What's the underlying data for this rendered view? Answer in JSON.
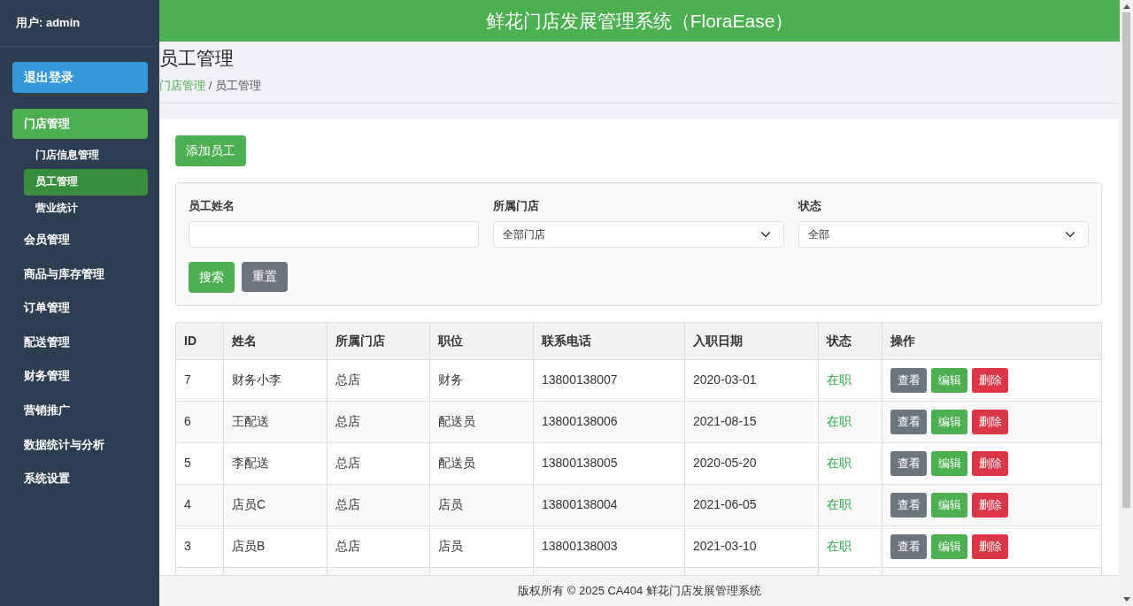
{
  "sidebar": {
    "user": "用户: admin",
    "logout": "退出登录",
    "menu": [
      {
        "label": "门店管理",
        "selected": true,
        "children": [
          {
            "label": "门店信息管理",
            "selected": false
          },
          {
            "label": "员工管理",
            "selected": true
          },
          {
            "label": "营业统计",
            "selected": false
          }
        ]
      },
      {
        "label": "会员管理",
        "selected": false
      },
      {
        "label": "商品与库存管理",
        "selected": false
      },
      {
        "label": "订单管理",
        "selected": false
      },
      {
        "label": "配送管理",
        "selected": false
      },
      {
        "label": "财务管理",
        "selected": false
      },
      {
        "label": "营销推广",
        "selected": false
      },
      {
        "label": "数据统计与分析",
        "selected": false
      },
      {
        "label": "系统设置",
        "selected": false
      }
    ]
  },
  "header": {
    "title": "鲜花门店发展管理系统（FloraEase）"
  },
  "page": {
    "title": "员工管理",
    "breadcrumb": [
      {
        "label": "门店管理",
        "kind": "link"
      },
      {
        "label": "/",
        "kind": "separator"
      },
      {
        "label": "员工管理",
        "kind": "current"
      }
    ]
  },
  "add_button": "添加员工",
  "filters": {
    "fields": [
      {
        "label": "员工姓名",
        "kind": "text"
      },
      {
        "label": "所属门店",
        "kind": "select",
        "value": "全部门店"
      },
      {
        "label": "状态",
        "kind": "select",
        "value": "全部"
      }
    ],
    "buttons": [
      {
        "label": "搜索",
        "kind": "primary"
      },
      {
        "label": "重置",
        "kind": "secondary"
      }
    ]
  },
  "table": {
    "columns": [
      "ID",
      "姓名",
      "所属门店",
      "职位",
      "联系电话",
      "入职日期",
      "状态",
      "操作"
    ],
    "rows": [
      {
        "cells": [
          "7",
          "财务小李",
          "总店",
          "财务",
          "13800138007",
          "2020-03-01",
          "在职"
        ],
        "actions": [
          "查看",
          "编辑",
          "删除"
        ]
      },
      {
        "cells": [
          "6",
          "王配送",
          "总店",
          "配送员",
          "13800138006",
          "2021-08-15",
          "在职"
        ],
        "actions": [
          "查看",
          "编辑",
          "删除"
        ]
      },
      {
        "cells": [
          "5",
          "李配送",
          "总店",
          "配送员",
          "13800138005",
          "2020-05-20",
          "在职"
        ],
        "actions": [
          "查看",
          "编辑",
          "删除"
        ]
      },
      {
        "cells": [
          "4",
          "店员C",
          "总店",
          "店员",
          "13800138004",
          "2021-06-05",
          "在职"
        ],
        "actions": [
          "查看",
          "编辑",
          "删除"
        ]
      },
      {
        "cells": [
          "3",
          "店员B",
          "总店",
          "店员",
          "13800138003",
          "2021-03-10",
          "在职"
        ],
        "actions": [
          "查看",
          "编辑",
          "删除"
        ]
      }
    ]
  },
  "footer": "版权所有 © 2025 CA404 鲜花门店发展管理系统"
}
